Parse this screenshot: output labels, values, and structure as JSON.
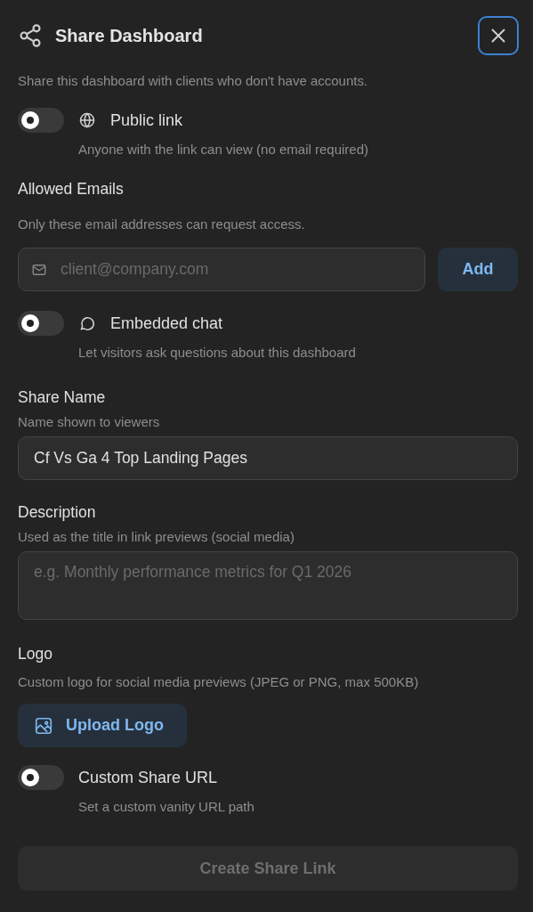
{
  "dialog": {
    "title": "Share Dashboard",
    "subtitle": "Share this dashboard with clients who don't have accounts."
  },
  "public_link": {
    "label": "Public link",
    "description": "Anyone with the link can view (no email required)",
    "on": false
  },
  "allowed_emails": {
    "heading": "Allowed Emails",
    "description": "Only these email addresses can request access.",
    "placeholder": "client@company.com",
    "button": "Add"
  },
  "embedded_chat": {
    "label": "Embedded chat",
    "description": "Let visitors ask questions about this dashboard",
    "on": false
  },
  "share_name": {
    "heading": "Share Name",
    "hint": "Name shown to viewers",
    "value": "Cf Vs Ga 4 Top Landing Pages"
  },
  "description": {
    "heading": "Description",
    "hint": "Used as the title in link previews (social media)",
    "placeholder": "e.g. Monthly performance metrics for Q1 2026"
  },
  "logo": {
    "heading": "Logo",
    "hint": "Custom logo for social media previews (JPEG or PNG, max 500KB)",
    "button": "Upload Logo"
  },
  "custom_url": {
    "label": "Custom Share URL",
    "description": "Set a custom vanity URL path",
    "on": false
  },
  "create_button": {
    "label": "Create Share Link",
    "disabled": true
  }
}
